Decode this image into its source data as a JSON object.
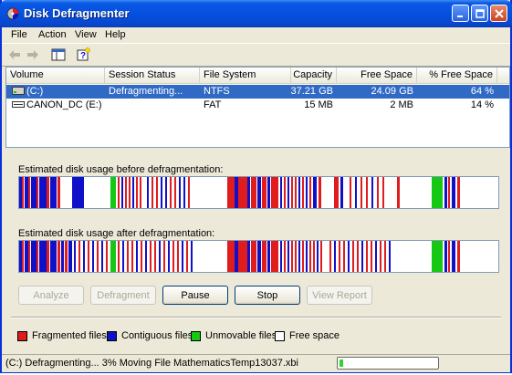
{
  "window": {
    "title": "Disk Defragmenter"
  },
  "menu": [
    "File",
    "Action",
    "View",
    "Help"
  ],
  "columns": [
    "Volume",
    "Session Status",
    "File System",
    "Capacity",
    "Free Space",
    "% Free Space"
  ],
  "volumes": [
    {
      "name": "(C:)",
      "status": "Defragmenting...",
      "fs": "NTFS",
      "capacity": "37.21 GB",
      "free": "24.09 GB",
      "pct": "64 %",
      "selected": true
    },
    {
      "name": "CANON_DC (E:)",
      "status": "",
      "fs": "FAT",
      "capacity": "15 MB",
      "free": "2 MB",
      "pct": "14 %",
      "selected": false
    }
  ],
  "labels": {
    "before": "Estimated disk usage before defragmentation:",
    "after": "Estimated disk usage after defragmentation:"
  },
  "buttons": {
    "analyze": "Analyze",
    "defragment": "Defragment",
    "pause": "Pause",
    "stop": "Stop",
    "report": "View Report"
  },
  "legend": {
    "fragmented": "Fragmented files",
    "contiguous": "Contiguous files",
    "unmovable": "Unmovable files",
    "free": "Free space"
  },
  "colors": {
    "fragmented": "#e01c1c",
    "contiguous": "#1010c8",
    "unmovable": "#14c814",
    "free": "#ffffff"
  },
  "status": {
    "text": "(C:) Defragmenting... 3%  Moving File MathematicsTemp13037.xbi",
    "progress": 0.03
  }
}
